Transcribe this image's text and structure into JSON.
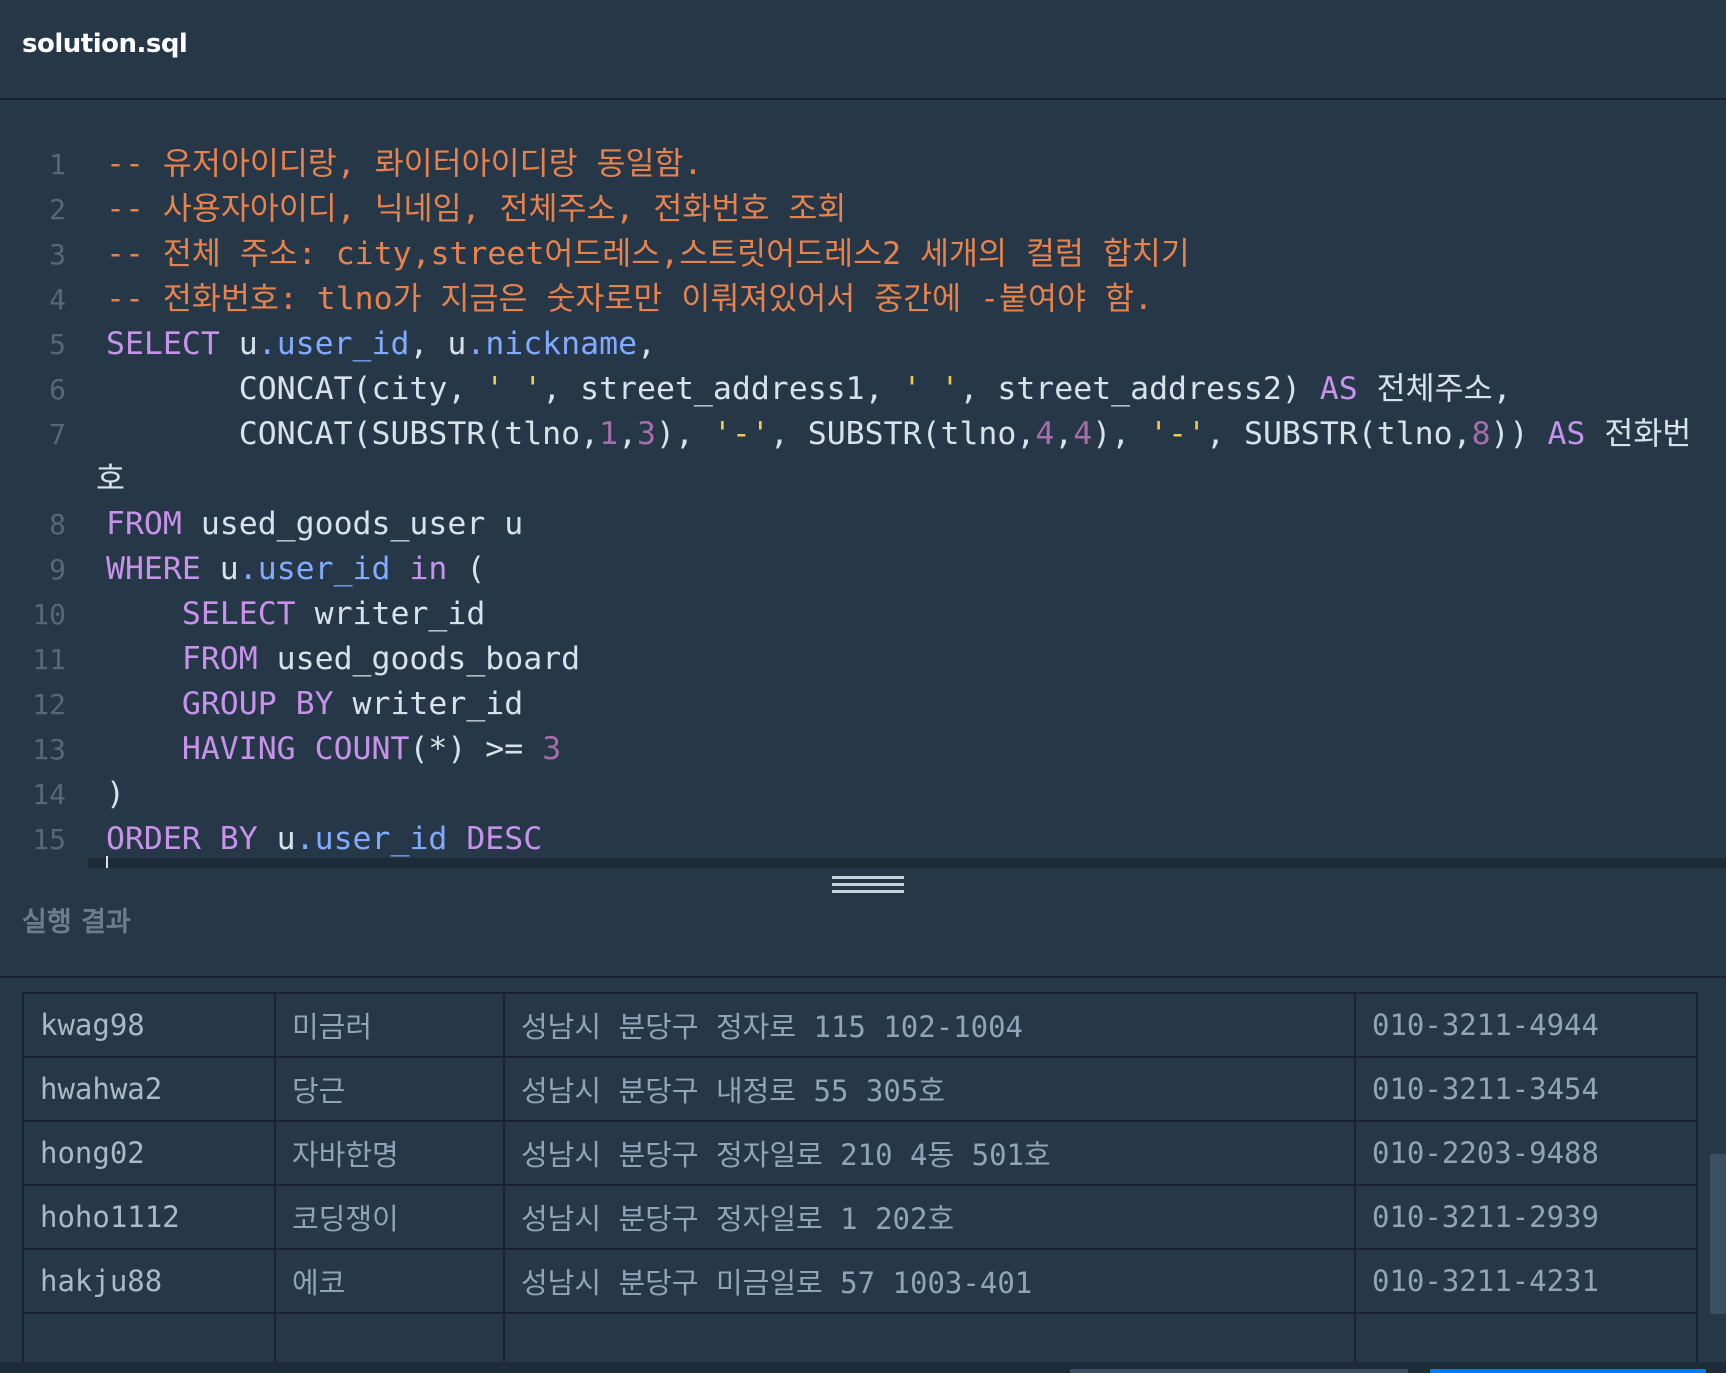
{
  "file": {
    "title": "solution.sql"
  },
  "editor": {
    "lines": [
      {
        "n": "1",
        "segs": [
          {
            "c": "cm",
            "t": "-- 유저아이디랑, 롸이터아이디랑 동일함."
          }
        ]
      },
      {
        "n": "2",
        "segs": [
          {
            "c": "cm",
            "t": "-- 사용자아이디, 닉네임, 전체주소, 전화번호 조회"
          }
        ]
      },
      {
        "n": "3",
        "segs": [
          {
            "c": "cm",
            "t": "-- 전체 주소: city,street어드레스,스트릿어드레스2 세개의 컬럼 합치기"
          }
        ]
      },
      {
        "n": "4",
        "segs": [
          {
            "c": "cm",
            "t": "-- 전화번호: tlno가 지금은 숫자로만 이뤄져있어서 중간에 -붙여야 함."
          }
        ]
      },
      {
        "n": "5",
        "segs": [
          {
            "c": "kw",
            "t": "SELECT"
          },
          {
            "c": "",
            "t": " u"
          },
          {
            "c": "fld",
            "t": ".user_id"
          },
          {
            "c": "",
            "t": ", u"
          },
          {
            "c": "fld",
            "t": ".nickname"
          },
          {
            "c": "",
            "t": ","
          }
        ]
      },
      {
        "n": "6",
        "segs": [
          {
            "c": "",
            "t": "       CONCAT(city, "
          },
          {
            "c": "str",
            "t": "' '"
          },
          {
            "c": "",
            "t": ", street_address1, "
          },
          {
            "c": "str",
            "t": "' '"
          },
          {
            "c": "",
            "t": ", street_address2) "
          },
          {
            "c": "kw",
            "t": "AS"
          },
          {
            "c": "",
            "t": " 전체주소,"
          }
        ]
      },
      {
        "n": "7",
        "segs": [
          {
            "c": "",
            "t": "       CONCAT(SUBSTR(tlno,"
          },
          {
            "c": "num",
            "t": "1"
          },
          {
            "c": "",
            "t": ","
          },
          {
            "c": "num",
            "t": "3"
          },
          {
            "c": "",
            "t": "), "
          },
          {
            "c": "str",
            "t": "'-'"
          },
          {
            "c": "",
            "t": ", SUBSTR(tlno,"
          },
          {
            "c": "num",
            "t": "4"
          },
          {
            "c": "",
            "t": ","
          },
          {
            "c": "num",
            "t": "4"
          },
          {
            "c": "",
            "t": "), "
          },
          {
            "c": "str",
            "t": "'-'"
          },
          {
            "c": "",
            "t": ", SUBSTR(tlno,"
          },
          {
            "c": "num",
            "t": "8"
          },
          {
            "c": "",
            "t": ")) "
          },
          {
            "c": "kw",
            "t": "AS"
          },
          {
            "c": "",
            "t": " 전화번"
          }
        ]
      },
      {
        "n": "",
        "wrap": true,
        "segs": [
          {
            "c": "",
            "t": "호"
          }
        ]
      },
      {
        "n": "8",
        "segs": [
          {
            "c": "kw",
            "t": "FROM"
          },
          {
            "c": "",
            "t": " used_goods_user u"
          }
        ]
      },
      {
        "n": "9",
        "segs": [
          {
            "c": "kw",
            "t": "WHERE"
          },
          {
            "c": "",
            "t": " u"
          },
          {
            "c": "fld",
            "t": ".user_id"
          },
          {
            "c": "",
            "t": " "
          },
          {
            "c": "kw",
            "t": "in"
          },
          {
            "c": "",
            "t": " ("
          }
        ]
      },
      {
        "n": "10",
        "segs": [
          {
            "c": "",
            "t": "    "
          },
          {
            "c": "kw",
            "t": "SELECT"
          },
          {
            "c": "",
            "t": " writer_id"
          }
        ]
      },
      {
        "n": "11",
        "segs": [
          {
            "c": "",
            "t": "    "
          },
          {
            "c": "kw",
            "t": "FROM"
          },
          {
            "c": "",
            "t": " used_goods_board"
          }
        ]
      },
      {
        "n": "12",
        "segs": [
          {
            "c": "",
            "t": "    "
          },
          {
            "c": "kw",
            "t": "GROUP BY"
          },
          {
            "c": "",
            "t": " writer_id"
          }
        ]
      },
      {
        "n": "13",
        "segs": [
          {
            "c": "",
            "t": "    "
          },
          {
            "c": "kw",
            "t": "HAVING COUNT"
          },
          {
            "c": "",
            "t": "(*) >= "
          },
          {
            "c": "num",
            "t": "3"
          }
        ]
      },
      {
        "n": "14",
        "segs": [
          {
            "c": "",
            "t": ")"
          }
        ]
      },
      {
        "n": "15",
        "segs": [
          {
            "c": "kw",
            "t": "ORDER BY"
          },
          {
            "c": "",
            "t": " u"
          },
          {
            "c": "fld",
            "t": ".user_id"
          },
          {
            "c": "",
            "t": " "
          },
          {
            "c": "kw",
            "t": "DESC"
          }
        ]
      }
    ]
  },
  "results": {
    "title": "실행 결과",
    "rows": [
      [
        "kwag98",
        "미금러",
        "성남시 분당구 정자로 115 102-1004",
        "010-3211-4944"
      ],
      [
        "hwahwa2",
        "당근",
        "성남시 분당구 내정로 55 305호",
        "010-3211-3454"
      ],
      [
        "hong02",
        "자바한명",
        "성남시 분당구 정자일로 210 4동 501호",
        "010-2203-9488"
      ],
      [
        "hoho1112",
        "코딩쟁이",
        "성남시 분당구 정자일로 1 202호",
        "010-3211-2939"
      ],
      [
        "hakju88",
        "에코",
        "성남시 분당구 미금일로 57 1003-401",
        "010-3211-4231"
      ],
      [
        "",
        "",
        "",
        ""
      ]
    ]
  }
}
